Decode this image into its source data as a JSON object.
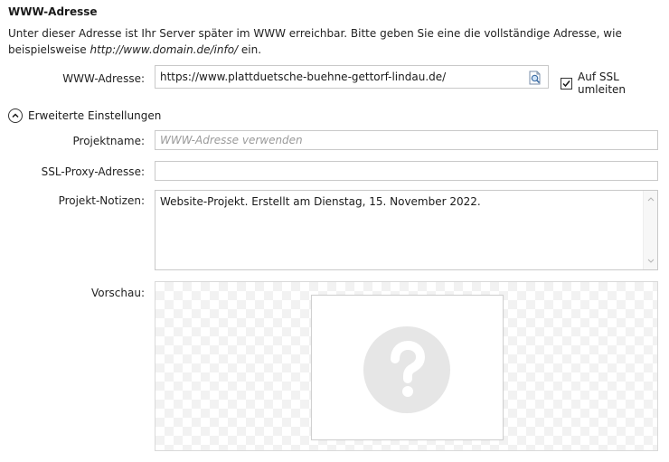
{
  "section": {
    "title": "WWW-Adresse",
    "description_part1": "Unter dieser Adresse ist Ihr Server später im WWW erreichbar. Bitte geben Sie eine die vollständige Adresse, wie beispielsweise ",
    "description_example": "http://www.domain.de/info/",
    "description_part2": " ein."
  },
  "www": {
    "label": "WWW-Adresse:",
    "value": "https://www.plattduetsche-buehne-gettorf-lindau.de/",
    "browse_icon": "document-search-icon"
  },
  "ssl_redirect": {
    "label": "Auf SSL umleiten",
    "checked": true
  },
  "advanced": {
    "label": "Erweiterte Einstellungen",
    "expanded": true,
    "icon": "chevron-up-icon"
  },
  "project_name": {
    "label": "Projektname:",
    "value": "",
    "placeholder": "WWW-Adresse verwenden"
  },
  "ssl_proxy": {
    "label": "SSL-Proxy-Adresse:",
    "value": ""
  },
  "notes": {
    "label": "Projekt-Notizen:",
    "value": "Website-Projekt. Erstellt am Dienstag, 15. November 2022."
  },
  "preview": {
    "label": "Vorschau:",
    "icon": "question-mark-icon"
  },
  "colors": {
    "field_border": "#c9c9c9",
    "placeholder": "#9a9a9a",
    "preview_icon": "#e6e6e6"
  }
}
